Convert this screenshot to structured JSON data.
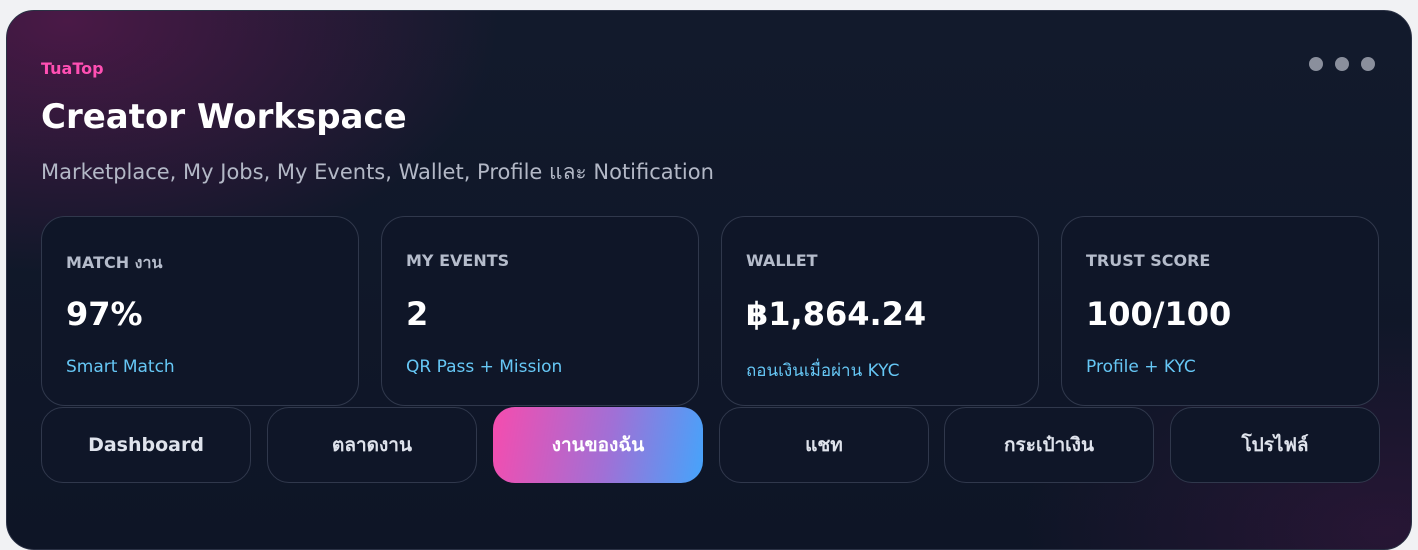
{
  "header": {
    "brand": "TuaTop",
    "title": "Creator Workspace",
    "subtitle": "Marketplace, My Jobs, My Events, Wallet, Profile และ Notification"
  },
  "stats": [
    {
      "label": "MATCH งาน",
      "value": "97%",
      "note": "Smart Match"
    },
    {
      "label": "MY EVENTS",
      "value": "2",
      "note": "QR Pass + Mission"
    },
    {
      "label": "WALLET",
      "value": "฿1,864.24",
      "note": "ถอนเงินเมื่อผ่าน KYC"
    },
    {
      "label": "TRUST SCORE",
      "value": "100/100",
      "note": "Profile + KYC"
    }
  ],
  "tabs": [
    {
      "label": "Dashboard",
      "active": false
    },
    {
      "label": "ตลาดงาน",
      "active": false
    },
    {
      "label": "งานของฉัน",
      "active": true
    },
    {
      "label": "แชท",
      "active": false
    },
    {
      "label": "กระเป๋าเงิน",
      "active": false
    },
    {
      "label": "โปรไฟล์",
      "active": false
    }
  ],
  "colors": {
    "brand": "#ff4fb3",
    "note": "#66c7f5",
    "active_tab_start": "#f64cae",
    "active_tab_end": "#45a4fb"
  },
  "icons": {
    "menu": "more-dots-icon"
  }
}
